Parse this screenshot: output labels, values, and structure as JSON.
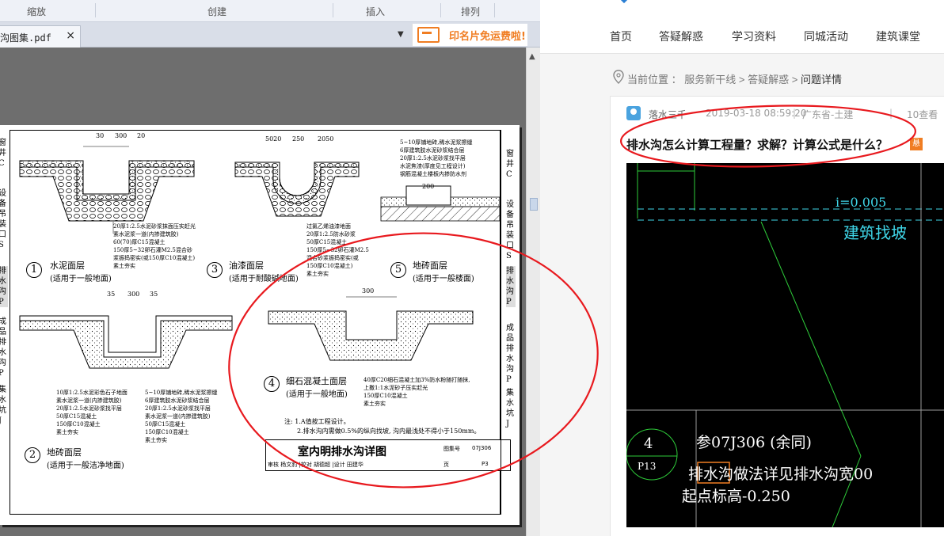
{
  "pdf_app": {
    "ribbon_groups": [
      "缩放",
      "创建",
      "插入",
      "排列"
    ],
    "tab": {
      "filename": "沟图集.pdf",
      "close": "×"
    },
    "tab_dropdown": "▼",
    "promo": {
      "text": "印名片免运费啦!",
      "accent": "#f07d22"
    },
    "scroll_up": "▲"
  },
  "drawing": {
    "dims": {
      "d1": "30",
      "d2": "300",
      "d3": "20",
      "d4": "5020",
      "d5": "250",
      "d6": "2050",
      "d7": "200",
      "d8": "35",
      "d9": "300",
      "d10": "35",
      "d11": "300"
    },
    "sections": [
      {
        "num": "1",
        "title": "水泥面层",
        "sub": "(适用于一般地面)"
      },
      {
        "num": "3",
        "title": "油漆面层",
        "sub": "(适用于耐酸碱地面)"
      },
      {
        "num": "5",
        "title": "地砖面层",
        "sub": "(适用于一般楼面)"
      },
      {
        "num": "2",
        "title": "地砖面层",
        "sub": "(适用于一般洁净地面)"
      },
      {
        "num": "4",
        "title": "细石混凝土面层",
        "sub": "(适用于一般地面)"
      }
    ],
    "notes_1": [
      "20厚1:2.5水泥砂浆抹面压实赶光",
      "素水泥浆一道(内掺建筑胶)",
      "60(70)厚C15混凝土",
      "150厚5~32卵石灌M2.5混合砂",
      "浆振捣密实(或150厚C10混凝土)",
      "素土夯实"
    ],
    "notes_3": [
      "过氯乙烯油漆地面",
      "20厚1:2.5防水砂浆",
      "50厚C15混凝土",
      "150厚5~32卵石灌M2.5",
      "混合砂浆振捣密实(或",
      "150厚C10混凝土)",
      "素土夯实"
    ],
    "notes_5": [
      "5~10厚铺地砖,稀水泥浆擦缝",
      "6厚建筑胶水泥砂浆结合层",
      "20厚1:2.5水泥砂浆找平层",
      "水泥焦渣(厚度见工程设计)",
      "钢筋混凝土楼板内掺防水剂"
    ],
    "notes_2a": [
      "10厚1:2.5水泥彩色石子地面",
      "素水泥浆一道(内掺建筑胶)",
      "20厚1:2.5水泥砂浆找平层",
      "50厚C15混凝土",
      "150厚C10混凝土",
      "素土夯实"
    ],
    "notes_2b": [
      "5~10厚铺地砖,稀水泥浆擦缝",
      "6厚建筑胶水泥砂浆结合层",
      "20厚1:2.5水泥砂浆找平层",
      "素水泥浆一道(内掺建筑胶)",
      "50厚C15混凝土",
      "150厚C10混凝土",
      "素土夯实"
    ],
    "notes_4": [
      "40厚C20细石混凝土加3%防水粉随打随抹,",
      "上撒1:1水泥砂子压实赶光",
      "150厚C10混凝土",
      "素土夯实"
    ],
    "footnotes": [
      "注: 1.A值按工程设计。",
      "2.排水沟内需做0.5%的纵向找坡, 沟内最浅处不得小于150mm。"
    ],
    "title_block": {
      "title": "室内明排水沟详图",
      "album_label": "图集号",
      "album_code": "07J306",
      "row2": "审核 杨文豹 |校对 胡德超 |设计 田建华",
      "page_label": "页",
      "page": "P3"
    },
    "side_right": [
      "窗井C",
      "设备吊装口S",
      "排水沟P",
      "成品排水沟P",
      "集水坑J"
    ],
    "side_left": [
      "窗井C",
      "设备吊装口S",
      "排水沟P",
      "成品排水沟P",
      "集水坑J"
    ]
  },
  "site": {
    "nav": [
      "首页",
      "答疑解惑",
      "学习资料",
      "同城活动",
      "建筑课堂"
    ],
    "breadcrumb": {
      "prefix": "当前位置 ：",
      "items": [
        "服务新干线",
        "答疑解惑"
      ],
      "current": "问题详情",
      "sep": ">"
    },
    "meta": {
      "author": "落水三千",
      "date": "2019-03-18 08:59:20",
      "location": "广东省-土建",
      "views": "10查看"
    },
    "question_title": "排水沟怎么计算工程量？求解？计算公式是什么？",
    "question_badge": "悬"
  },
  "cad": {
    "slope_text": "i=0.005",
    "slope_note": "建筑找坡",
    "detail_num": "4",
    "detail_page": "P13",
    "ref": "参07J306  (余同)",
    "note1": "排水沟做法详见排水沟宽00",
    "note2": "起点标高-0.250"
  },
  "colors": {
    "annotation_red": "#e8191e",
    "cad_green": "#2ecc3a",
    "cad_cyan": "#3fd6e8"
  }
}
